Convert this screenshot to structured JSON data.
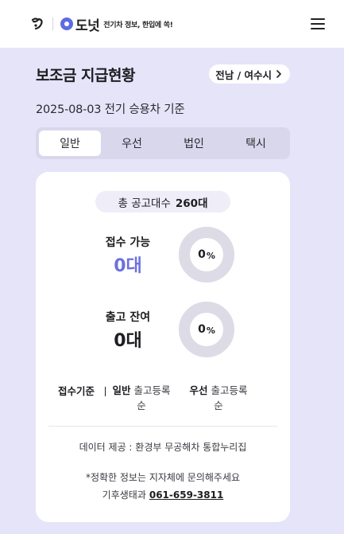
{
  "header": {
    "brand_name": "도넛",
    "brand_tagline": "전기차 정보, 한입에 쏙!",
    "menu_icon": "hamburger-menu-icon",
    "brand_color": "#5f6be0"
  },
  "page": {
    "title": "보조금 지급현황",
    "region_label": "전남 / 여수시",
    "date_line": "2025-08-03 전기 승용차 기준"
  },
  "tabs": [
    {
      "label": "일반",
      "active": true
    },
    {
      "label": "우선",
      "active": false
    },
    {
      "label": "법인",
      "active": false
    },
    {
      "label": "택시",
      "active": false
    }
  ],
  "summary": {
    "total_label": "총 공고대수",
    "total_value": "260대",
    "reception": {
      "label": "접수 가능",
      "value": "0대",
      "percent": "0",
      "percent_unit": "%",
      "ratio": 0,
      "color": "#6b72dc"
    },
    "release": {
      "label": "출고 잔여",
      "value": "0대",
      "percent": "0",
      "percent_unit": "%",
      "ratio": 0
    }
  },
  "criteria": {
    "title": "접수기준",
    "general_label": "일반",
    "general_text": "출고등록 순",
    "priority_label": "우선",
    "priority_text": "출고등록 순"
  },
  "footer": {
    "source": "데이터 제공 : 환경부 무공해차 통합누리집",
    "notice": "*정확한 정보는 지자체에 문의해주세요",
    "contact_label": "기후생태과",
    "contact_phone": "061-659-3811"
  }
}
